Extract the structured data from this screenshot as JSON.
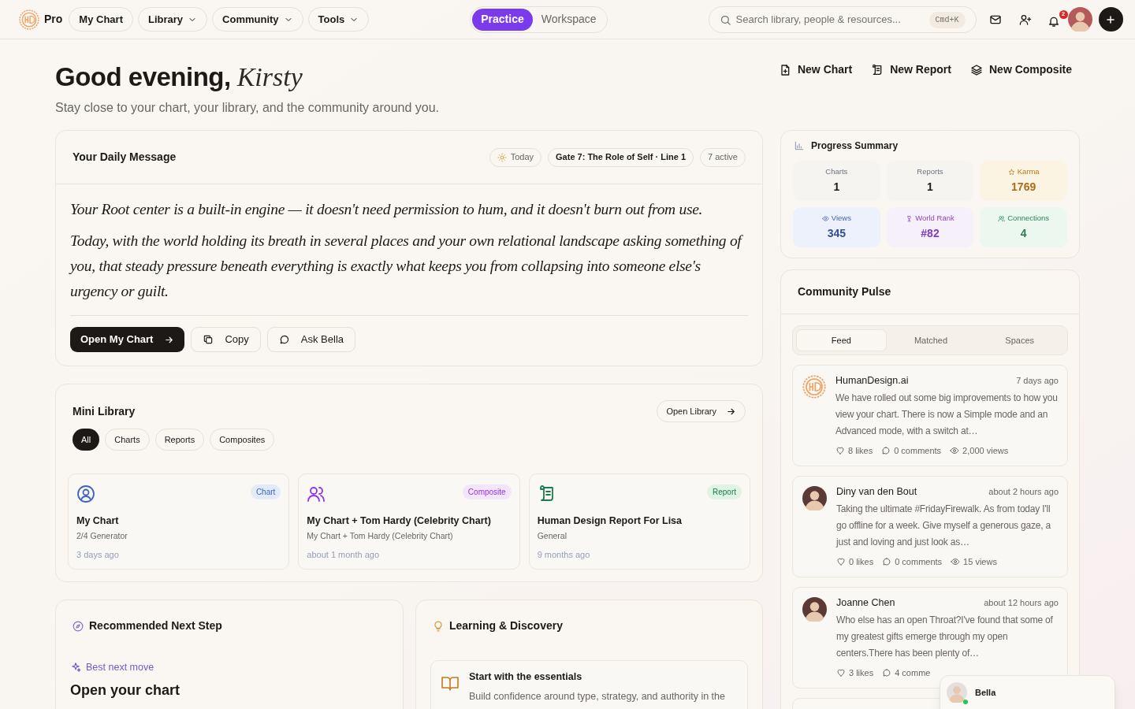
{
  "nav": {
    "brand": "Pro",
    "items": [
      {
        "label": "My Chart",
        "dropdown": false
      },
      {
        "label": "Library",
        "dropdown": true
      },
      {
        "label": "Community",
        "dropdown": true
      },
      {
        "label": "Tools",
        "dropdown": true
      }
    ],
    "mode_tabs": [
      {
        "label": "Practice",
        "selected": true
      },
      {
        "label": "Workspace",
        "selected": false
      }
    ],
    "search": {
      "placeholder": "Search library, people & resources...",
      "shortcut": "Cmd+K"
    },
    "notification_count": "2"
  },
  "greeting": {
    "text": "Good evening,",
    "name": "Kirsty",
    "subtitle": "Stay close to your chart, your library, and the community around you."
  },
  "quick_actions": [
    {
      "label": "New Chart",
      "kind": "chart"
    },
    {
      "label": "New Report",
      "kind": "report"
    },
    {
      "label": "New Composite",
      "kind": "composite"
    }
  ],
  "daily_message": {
    "title": "Your Daily Message",
    "badges": [
      {
        "label": "Today",
        "kind": "today"
      },
      {
        "label": "Gate 7: The Role of Self · Line 1",
        "kind": "gate"
      },
      {
        "label": "7 active",
        "kind": "count"
      }
    ],
    "paragraphs": [
      "Your Root center is a built-in engine — it doesn't need permission to hum, and it doesn't burn out from use.",
      "Today, with the world holding its breath in several places and your own relational landscape asking something of you, that steady pressure beneath everything is exactly what keeps you from collapsing into someone else's urgency or guilt."
    ],
    "actions": [
      {
        "label": "Open My Chart",
        "kind": "primary"
      },
      {
        "label": "Copy",
        "kind": "copy"
      },
      {
        "label": "Ask Bella",
        "kind": "chat"
      }
    ]
  },
  "mini_library": {
    "title": "Mini Library",
    "open_button": "Open Library",
    "filters": [
      {
        "label": "All",
        "selected": true
      },
      {
        "label": "Charts",
        "selected": false
      },
      {
        "label": "Reports",
        "selected": false
      },
      {
        "label": "Composites",
        "selected": false
      }
    ],
    "items": [
      {
        "kind": "chart",
        "tag": "Chart",
        "title": "My Chart",
        "subtitle": "2/4 Generator",
        "time": "3 days ago"
      },
      {
        "kind": "composite",
        "tag": "Composite",
        "title": "My Chart + Tom Hardy (Celebrity Chart)",
        "subtitle": "My Chart + Tom Hardy (Celebrity Chart)",
        "time": "about 1 month ago"
      },
      {
        "kind": "report",
        "tag": "Report",
        "title": "Human Design Report For Lisa",
        "subtitle": "General",
        "time": "9 months ago"
      }
    ]
  },
  "recommended": {
    "title": "Recommended Next Step",
    "eyebrow": "Best next move",
    "heading": "Open your chart"
  },
  "learning": {
    "title": "Learning & Discovery",
    "items": [
      {
        "title": "Start with the essentials",
        "description": "Build confidence around type, strategy, and authority in the"
      }
    ]
  },
  "progress": {
    "title": "Progress Summary",
    "stats": [
      {
        "label": "Charts",
        "value": "1",
        "kind": "plain"
      },
      {
        "label": "Reports",
        "value": "1",
        "kind": "plain"
      },
      {
        "label": "Karma",
        "value": "1769",
        "kind": "karma"
      },
      {
        "label": "Views",
        "value": "345",
        "kind": "views"
      },
      {
        "label": "World Rank",
        "value": "#82",
        "kind": "rank"
      },
      {
        "label": "Connections",
        "value": "4",
        "kind": "connections"
      }
    ]
  },
  "community": {
    "title": "Community Pulse",
    "tabs": [
      {
        "label": "Feed",
        "selected": true
      },
      {
        "label": "Matched",
        "selected": false
      },
      {
        "label": "Spaces",
        "selected": false
      }
    ],
    "posts": [
      {
        "author": "HumanDesign.ai",
        "kind": "brand",
        "time": "7 days ago",
        "text": "We have rolled out some big improvements to how you view your chart. There is now a Simple mode and an Advanced mode, with a switch at…",
        "stats": [
          {
            "kind": "likes",
            "label": "8 likes"
          },
          {
            "kind": "comments",
            "label": "0 comments"
          },
          {
            "kind": "views",
            "label": "2,000 views"
          }
        ]
      },
      {
        "author": "Diny van den Bout",
        "kind": "member",
        "time": "about 2 hours ago",
        "text": "Taking the ultimate #FridayFirewalk. As from today I'll go offline for a week. Give myself a generous gaze, a just and loving and just look as…",
        "stats": [
          {
            "kind": "likes",
            "label": "0 likes"
          },
          {
            "kind": "comments",
            "label": "0 comments"
          },
          {
            "kind": "views",
            "label": "15 views"
          }
        ]
      },
      {
        "author": "Joanne Chen",
        "kind": "member",
        "time": "about 12 hours ago",
        "text": "Who else has an open Throat?I've found that some of my greatest gifts emerge through my open centers.There has been plenty of…",
        "stats": [
          {
            "kind": "likes",
            "label": "3 likes"
          },
          {
            "kind": "comments",
            "label": "4 comme"
          }
        ]
      }
    ]
  },
  "assistant": {
    "name": "Bella",
    "online": true
  }
}
